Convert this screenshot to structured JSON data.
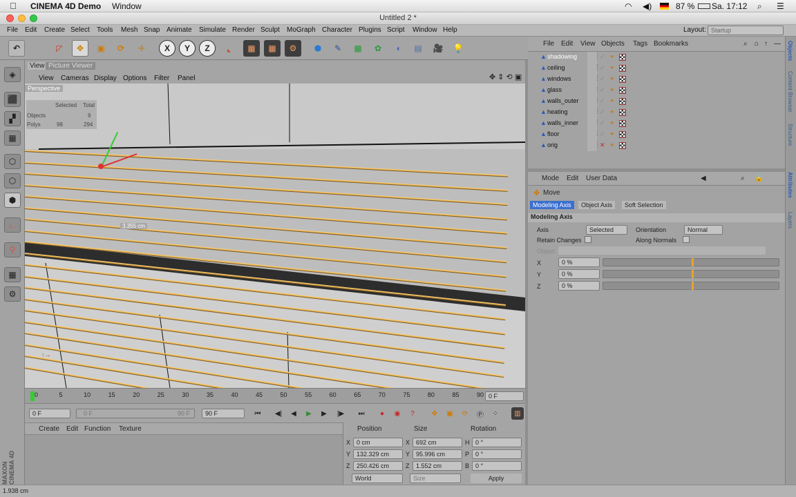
{
  "macbar": {
    "app": "CINEMA 4D Demo",
    "menu": "Window",
    "battery": "87 %",
    "clock": "Sa. 17:12"
  },
  "titlebar": {
    "title": "Untitled 2 *"
  },
  "menubar": {
    "items": [
      "File",
      "Edit",
      "Create",
      "Select",
      "Tools",
      "Mesh",
      "Snap",
      "Animate",
      "Simulate",
      "Render",
      "Sculpt",
      "MoGraph",
      "Character",
      "Plugins",
      "Script",
      "Window",
      "Help"
    ],
    "layout_label": "Layout:",
    "layout_value": "Startup"
  },
  "viewport": {
    "tabs": [
      "View",
      "Picture Viewer"
    ],
    "menu": [
      "View",
      "Cameras",
      "Display",
      "Options",
      "Filter",
      "Panel"
    ],
    "camera_label": "Perspective",
    "stats": {
      "col_selected": "Selected",
      "col_total": "Total",
      "row1": "Objects",
      "row1_total": "9",
      "row2": "Polys",
      "row2_sel": "98",
      "row2_total": "294"
    },
    "measure": "3.355 cm"
  },
  "timeline": {
    "ticks": [
      "0",
      "5",
      "10",
      "15",
      "20",
      "25",
      "30",
      "35",
      "40",
      "45",
      "50",
      "55",
      "60",
      "65",
      "70",
      "75",
      "80",
      "85",
      "90"
    ],
    "frame": "0 F"
  },
  "playbar": {
    "start": "0 F",
    "range_start": "0 F",
    "range_end": "90 F",
    "end": "90 F"
  },
  "materials": {
    "menu": [
      "Create",
      "Edit",
      "Function",
      "Texture"
    ]
  },
  "coords": {
    "headers": [
      "Position",
      "Size",
      "Rotation"
    ],
    "rows": [
      {
        "axis": "X",
        "pos": "0 cm",
        "size_axis": "X",
        "size": "692 cm",
        "rot_axis": "H",
        "rot": "0 °"
      },
      {
        "axis": "Y",
        "pos": "132.329 cm",
        "size_axis": "Y",
        "size": "95.996 cm",
        "rot_axis": "P",
        "rot": "0 °"
      },
      {
        "axis": "Z",
        "pos": "250.426 cm",
        "size_axis": "Z",
        "size": "1.552 cm",
        "rot_axis": "B",
        "rot": "0 °"
      }
    ],
    "mode_world": "World",
    "mode_size": "Size",
    "apply": "Apply"
  },
  "status": {
    "text": "1.938 cm"
  },
  "objects": {
    "menu": [
      "File",
      "Edit",
      "View",
      "Objects",
      "Tags",
      "Bookmarks"
    ],
    "items": [
      "shadowing",
      "ceiling",
      "windows",
      "glass",
      "walls_outer",
      "heating",
      "walls_inner",
      "floor",
      "orig"
    ]
  },
  "attributes": {
    "menu": [
      "Mode",
      "Edit",
      "User Data"
    ],
    "tool": "Move",
    "tabs": [
      "Modeling Axis",
      "Object Axis",
      "Soft Selection"
    ],
    "section": "Modeling Axis",
    "axis_label": "Axis",
    "axis_value": "Selected",
    "orientation_label": "Orientation",
    "orientation_value": "Normal",
    "retain_label": "Retain Changes",
    "along_label": "Along Normals",
    "object_label": "Object",
    "x_label": "X",
    "y_label": "Y",
    "z_label": "Z",
    "x_value": "0 %",
    "y_value": "0 %",
    "z_value": "0 %"
  },
  "right_tabs": [
    "Objects",
    "Content Browser",
    "Structure",
    "Attributes",
    "Layers"
  ],
  "colors": {
    "accent": "#3b6fd0",
    "blinds": "#e9a73a",
    "selected_row": "#7f99c9"
  }
}
